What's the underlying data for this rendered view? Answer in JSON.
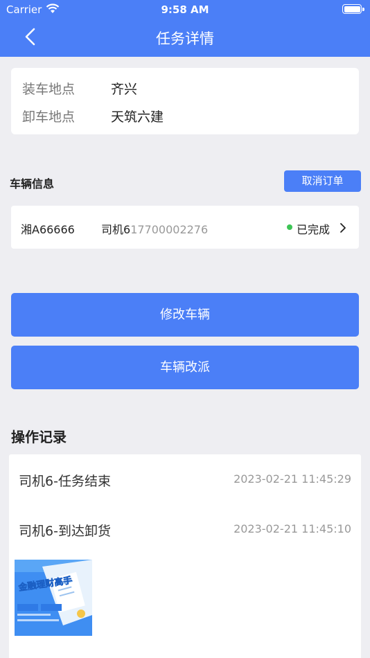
{
  "status_bar": {
    "carrier": "Carrier",
    "time": "9:58 AM"
  },
  "nav": {
    "title": "任务详情"
  },
  "address": {
    "load_label": "装车地点",
    "load_value": "齐兴",
    "unload_label": "卸车地点",
    "unload_value": "天筑六建"
  },
  "vehicle_section": {
    "title": "车辆信息",
    "cancel_label": "取消订单",
    "plate": "湘A66666",
    "driver_name": "司机6",
    "driver_phone": "17700002276",
    "status": "已完成",
    "status_color": "#3dc455"
  },
  "actions": {
    "modify_label": "修改车辆",
    "reassign_label": "车辆改派"
  },
  "log": {
    "title": "操作记录",
    "entries": [
      {
        "text": "司机6-任务结束",
        "time": "2023-02-21 11:45:29"
      },
      {
        "text": "司机6-到达卸货",
        "time": "2023-02-21 11:45:10"
      }
    ],
    "image_text": "金融理财高手"
  },
  "colors": {
    "accent": "#4b7ff7",
    "background": "#eeeef2"
  }
}
